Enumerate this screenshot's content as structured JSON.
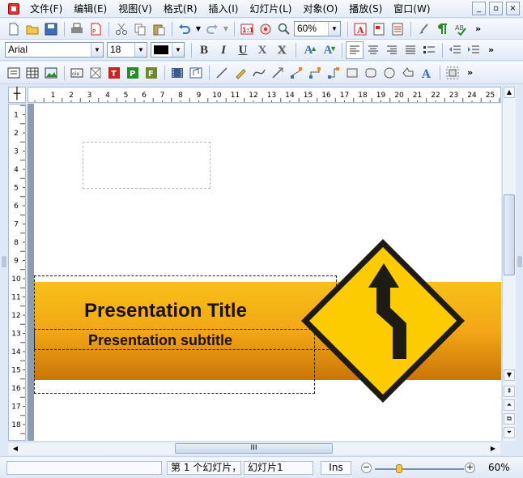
{
  "menu": [
    "文件(F)",
    "编辑(E)",
    "视图(V)",
    "格式(R)",
    "插入(I)",
    "幻灯片(L)",
    "对象(O)",
    "播放(S)",
    "窗口(W)"
  ],
  "window_buttons": [
    "_",
    "▫",
    "×"
  ],
  "toolbar1": {
    "zoom_value": "60%",
    "icons": [
      "new-icon",
      "open-icon",
      "save-icon",
      "print-icon",
      "pdf-icon",
      "cut-icon",
      "copy-icon",
      "paste-icon",
      "undo-icon",
      "redo-icon",
      "actual-size-icon",
      "zoom-icon",
      "zoom-search-icon",
      "text-color-icon",
      "page-icon",
      "list-icon",
      "brush-icon",
      "paragraph-mark-icon",
      "spellcheck-icon"
    ],
    "more": "»"
  },
  "toolbar2": {
    "font_name": "Arial",
    "font_size": "18",
    "bold": "B",
    "italic": "I",
    "underline": "U",
    "strike": "X",
    "shadow": "X",
    "grow": "A",
    "shrink": "A",
    "more": "»"
  },
  "toolbar3": {
    "icons": [
      "textbox-icon",
      "table-icon",
      "image-icon",
      "ole-icon",
      "frame-icon",
      "title-placeholder-icon",
      "placeholder-p-icon",
      "placeholder-f-icon",
      "film-icon",
      "audio-icon",
      "line-icon",
      "pencil-icon",
      "curve-icon",
      "arrow-icon",
      "connector-icon",
      "connector2-icon",
      "elbow-connector-icon",
      "rectangle-icon",
      "rounded-rect-icon",
      "ellipse-icon",
      "shape-icon",
      "wordart-icon",
      "group-icon"
    ],
    "more": "»"
  },
  "ruler": {
    "corner": "┼",
    "h_numbers": [
      "1",
      "2",
      "3",
      "4",
      "5",
      "6",
      "7",
      "8",
      "9",
      "10",
      "11",
      "12",
      "13",
      "14",
      "15",
      "16",
      "17",
      "18",
      "19",
      "20",
      "21",
      "22",
      "23",
      "24",
      "25"
    ],
    "v_numbers": [
      "1",
      "2",
      "3",
      "4",
      "5",
      "6",
      "7",
      "8",
      "9",
      "10",
      "11",
      "12",
      "13",
      "14",
      "15",
      "16",
      "17",
      "18"
    ]
  },
  "slide": {
    "title": "Presentation Title",
    "subtitle": "Presentation subtitle"
  },
  "scrollbar": {
    "thumb_grip": "III"
  },
  "status": {
    "slide_info": "第 1 个幻灯片，",
    "slide_name": "幻灯片1",
    "insert_mode": "Ins",
    "zoom": "60%",
    "zoom_level": 0.6
  },
  "colors": {
    "band_top": "#f7bf18",
    "band_bottom": "#c97507",
    "sign_yellow": "#fdcc00",
    "sign_border": "#1e1a14"
  }
}
